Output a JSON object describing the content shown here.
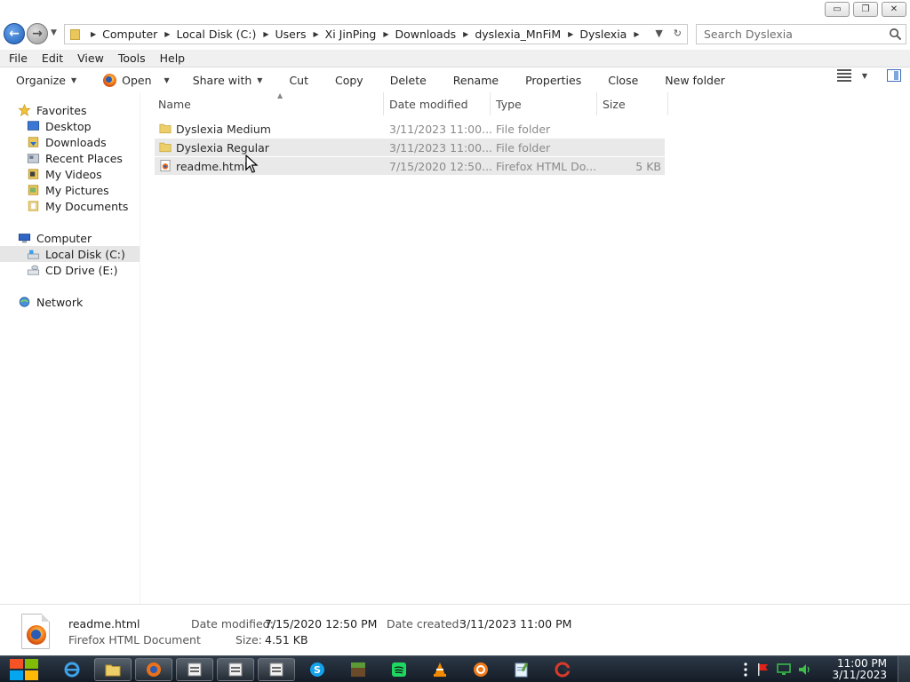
{
  "window": {
    "minimize_label": "▭",
    "restore_label": "❐",
    "close_label": "✕"
  },
  "address": {
    "breadcrumbs": [
      "Computer",
      "Local Disk (C:)",
      "Users",
      "Xi JinPing",
      "Downloads",
      "dyslexia_MnFiM",
      "Dyslexia"
    ]
  },
  "search": {
    "placeholder": "Search Dyslexia"
  },
  "menubar": {
    "items": [
      "File",
      "Edit",
      "View",
      "Tools",
      "Help"
    ]
  },
  "commands": {
    "organize": "Organize",
    "open": "Open",
    "share_with": "Share with",
    "cut": "Cut",
    "copy": "Copy",
    "delete": "Delete",
    "rename": "Rename",
    "properties": "Properties",
    "close": "Close",
    "new_folder": "New folder"
  },
  "sidebar": {
    "favorites": "Favorites",
    "desktop": "Desktop",
    "downloads": "Downloads",
    "recent_places": "Recent Places",
    "my_videos": "My Videos",
    "my_pictures": "My Pictures",
    "my_documents": "My Documents",
    "computer": "Computer",
    "local_disk": "Local Disk (C:)",
    "cd_drive": "CD Drive (E:)",
    "network": "Network"
  },
  "columns": {
    "name": "Name",
    "date_modified": "Date modified",
    "type": "Type",
    "size": "Size"
  },
  "files": [
    {
      "name": "Dyslexia Medium",
      "date": "3/11/2023 11:00...",
      "type": "File folder",
      "size": ""
    },
    {
      "name": "Dyslexia Regular",
      "date": "3/11/2023 11:00...",
      "type": "File folder",
      "size": ""
    },
    {
      "name": "readme.html",
      "date": "7/15/2020 12:50...",
      "type": "Firefox HTML Do...",
      "size": "5 KB"
    }
  ],
  "details": {
    "filename": "readme.html",
    "filetype": "Firefox HTML Document",
    "date_modified_label": "Date modified:",
    "date_modified_value": "7/15/2020 12:50 PM",
    "size_label": "Size:",
    "size_value": "4.51 KB",
    "date_created_label": "Date created:",
    "date_created_value": "3/11/2023 11:00 PM"
  },
  "taskbar": {
    "time": "11:00 PM",
    "date": "3/11/2023"
  }
}
